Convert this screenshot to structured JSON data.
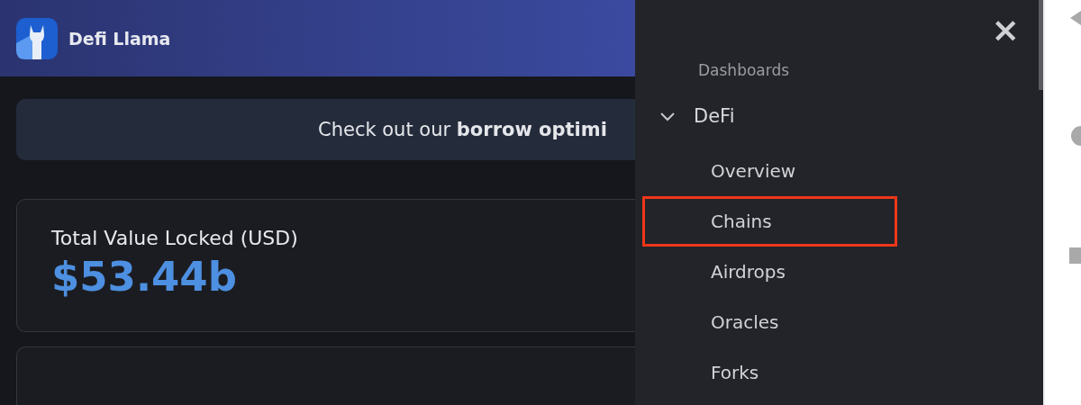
{
  "header": {
    "brand": "Defi Llama"
  },
  "banner": {
    "text": "Check out our **borrow optimi**"
  },
  "cards": [
    {
      "kind": "stat",
      "label": "Total Value Locked (USD)",
      "value": "$53.44b"
    },
    {
      "kind": "blank"
    }
  ],
  "drawer": {
    "close": "×",
    "section": "Dashboards",
    "groups": [
      {
        "label": "DeFi",
        "expanded": true,
        "children": [
          {
            "label": "Overview",
            "highlighted": false
          },
          {
            "label": "Chains",
            "highlighted": true
          },
          {
            "label": "Airdrops",
            "highlighted": false
          },
          {
            "label": "Oracles",
            "highlighted": false
          },
          {
            "label": "Forks",
            "highlighted": false
          }
        ]
      }
    ]
  }
}
